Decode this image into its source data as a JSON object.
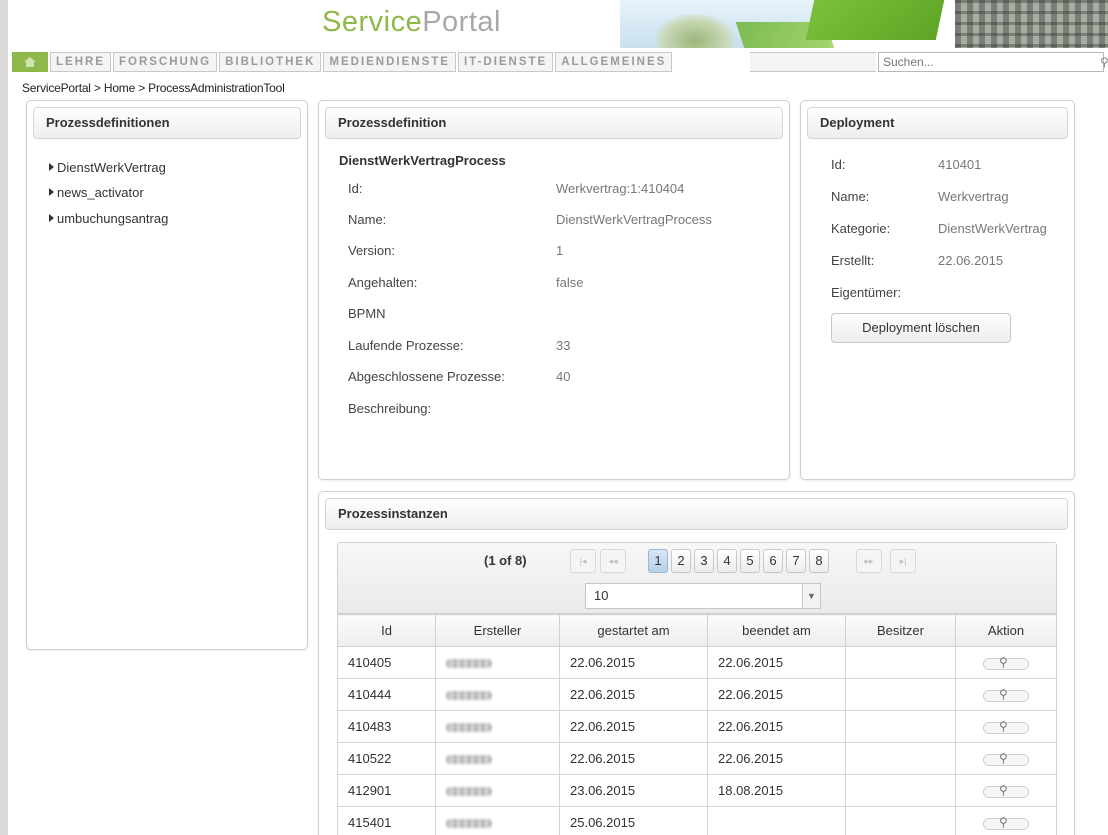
{
  "brand": {
    "part_a": "Service",
    "part_b": "Portal"
  },
  "nav": {
    "items": [
      "LEHRE",
      "FORSCHUNG",
      "BIBLIOTHEK",
      "MEDIENDIENSTE",
      "IT-DIENSTE",
      "ALLGEMEINES"
    ],
    "search_placeholder": "Suchen..."
  },
  "breadcrumb": {
    "items": [
      "ServicePortal",
      "Home",
      "ProcessAdministrationTool"
    ],
    "separator": ">"
  },
  "definitions": {
    "title": "Prozessdefinitionen",
    "items": [
      "DienstWerkVertrag",
      "news_activator",
      "umbuchungsantrag"
    ]
  },
  "definition": {
    "title": "Prozessdefinition",
    "process_name": "DienstWerkVertragProcess",
    "rows": [
      {
        "label": "Id:",
        "value": "Werkvertrag:1:410404"
      },
      {
        "label": "Name:",
        "value": "DienstWerkVertragProcess"
      },
      {
        "label": "Version:",
        "value": "1"
      },
      {
        "label": "Angehalten:",
        "value": "false"
      },
      {
        "label": "BPMN",
        "value": ""
      },
      {
        "label": "Laufende Prozesse:",
        "value": "33"
      },
      {
        "label": "Abgeschlossene Prozesse:",
        "value": "40"
      },
      {
        "label": "Beschreibung:",
        "value": ""
      }
    ]
  },
  "deployment": {
    "title": "Deployment",
    "rows": [
      {
        "label": "Id:",
        "value": "410401"
      },
      {
        "label": "Name:",
        "value": "Werkvertrag"
      },
      {
        "label": "Kategorie:",
        "value": "DienstWerkVertrag"
      },
      {
        "label": "Erstellt:",
        "value": "22.06.2015"
      },
      {
        "label": "Eigentümer:",
        "value": ""
      }
    ],
    "delete_label": "Deployment löschen"
  },
  "instances": {
    "title": "Prozessinstanzen",
    "page_info": "(1 of 8)",
    "pages": [
      "1",
      "2",
      "3",
      "4",
      "5",
      "6",
      "7",
      "8"
    ],
    "current_page": "1",
    "rows_per_page": "10",
    "columns": [
      "Id",
      "Ersteller",
      "gestartet am",
      "beendet am",
      "Besitzer",
      "Aktion"
    ],
    "rows": [
      {
        "id": "410405",
        "started": "22.06.2015",
        "ended": "22.06.2015"
      },
      {
        "id": "410444",
        "started": "22.06.2015",
        "ended": "22.06.2015"
      },
      {
        "id": "410483",
        "started": "22.06.2015",
        "ended": "22.06.2015"
      },
      {
        "id": "410522",
        "started": "22.06.2015",
        "ended": "22.06.2015"
      },
      {
        "id": "412901",
        "started": "23.06.2015",
        "ended": "18.08.2015"
      },
      {
        "id": "415401",
        "started": "25.06.2015",
        "ended": ""
      }
    ]
  },
  "colors": {
    "brand_green": "#8fb84a",
    "brand_grey": "#a8a8a8",
    "active_page": "#b6d1e8"
  }
}
